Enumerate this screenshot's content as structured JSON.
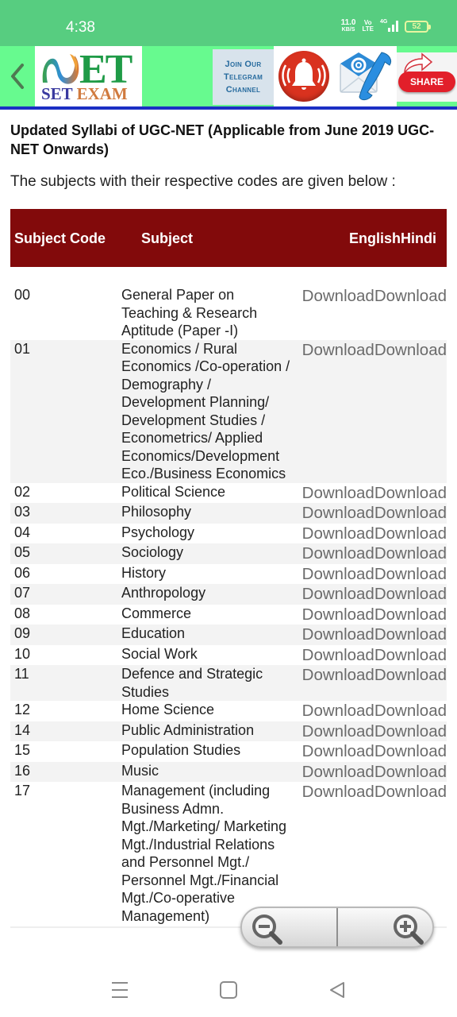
{
  "status_bar": {
    "time": "4:38",
    "net_speed": "11.0",
    "net_speed_unit": "KB/S",
    "volte": "Vo LTE",
    "network": "4G",
    "battery": "52"
  },
  "header": {
    "back_icon": "chevron-left-icon",
    "logo": {
      "main": "ET",
      "sub_set": "SET",
      "sub_exam": "EXAM"
    },
    "telegram": {
      "line1": "Join Our",
      "line2": "Telegram",
      "line3": "Channel"
    },
    "bell_icon": "bell-icon",
    "contact_icon": "email-phone-icon",
    "share_label": "SHARE"
  },
  "content": {
    "title": "Updated Syllabi of UGC-NET (Applicable from June 2019 UGC-NET Onwards)",
    "intro": "The subjects with their respective codes are given below :",
    "table": {
      "headers": {
        "code": "Subject Code",
        "subject": "Subject",
        "english": "English",
        "hindi": "Hindi"
      },
      "rows": [
        {
          "code": "00",
          "subject": "General Paper on Teaching & Research Aptitude (Paper -I)",
          "english": "Download",
          "hindi": "Download"
        },
        {
          "code": "01",
          "subject": "Economics / Rural Economics /Co-operation / Demography / Development Planning/ Development Studies / Econometrics/ Applied Economics/Development Eco./Business Economics",
          "english": "Download",
          "hindi": "Download"
        },
        {
          "code": "02",
          "subject": "Political Science",
          "english": "Download",
          "hindi": "Download"
        },
        {
          "code": "03",
          "subject": "Philosophy",
          "english": "Download",
          "hindi": "Download"
        },
        {
          "code": "04",
          "subject": "Psychology",
          "english": "Download",
          "hindi": "Download"
        },
        {
          "code": "05",
          "subject": "Sociology",
          "english": "Download",
          "hindi": "Download"
        },
        {
          "code": "06",
          "subject": "History",
          "english": "Download",
          "hindi": "Download"
        },
        {
          "code": "07",
          "subject": "Anthropology",
          "english": "Download",
          "hindi": "Download"
        },
        {
          "code": "08",
          "subject": "Commerce",
          "english": "Download",
          "hindi": "Download"
        },
        {
          "code": "09",
          "subject": "Education",
          "english": "Download",
          "hindi": "Download"
        },
        {
          "code": "10",
          "subject": "Social Work",
          "english": "Download",
          "hindi": "Download"
        },
        {
          "code": "11",
          "subject": "Defence and Strategic Studies",
          "english": "Download",
          "hindi": "Download"
        },
        {
          "code": "12",
          "subject": "Home Science",
          "english": "Download",
          "hindi": "Download"
        },
        {
          "code": "14",
          "subject": "Public Administration",
          "english": "Download",
          "hindi": "Download"
        },
        {
          "code": "15",
          "subject": "Population Studies",
          "english": "Download",
          "hindi": "Download"
        },
        {
          "code": "16",
          "subject": "Music",
          "english": "Download",
          "hindi": "Download"
        },
        {
          "code": "17",
          "subject": "Management (including Business Admn. Mgt./Marketing/ Marketing Mgt./Industrial Relations and Personnel Mgt./ Personnel Mgt./Financial Mgt./Co-operative Management)",
          "english": "Download",
          "hindi": "Download"
        }
      ]
    }
  },
  "zoom_control": {
    "zoom_out_icon": "zoom-out-icon",
    "zoom_in_icon": "zoom-in-icon"
  },
  "nav_bar": {
    "menu_icon": "menu-icon",
    "home_icon": "home-icon",
    "back_icon": "back-triangle-icon"
  },
  "colors": {
    "status_bar": "#57cd80",
    "header_bg": "#67fa8f",
    "header_border": "#1b2fc4",
    "table_header": "#820a0b",
    "row_alt": "#f3f3f3",
    "download_link": "#6b6b6b"
  }
}
